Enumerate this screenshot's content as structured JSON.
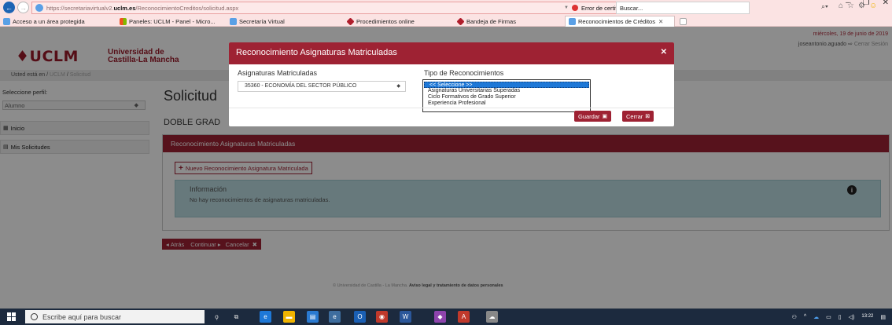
{
  "browser": {
    "url_prefix": "https://secretariavirtualv2.",
    "url_domain": "uclm.es",
    "url_path": "/ReconocimientoCreditos/solicitud.aspx",
    "cert_error": "Error de certificado",
    "search_placeholder": "Buscar...",
    "favorites": [
      "Acceso a un área protegida",
      "Paneles: UCLM - Panel - Micro...",
      "Secretaría Virtual",
      "Procedimientos online",
      "Bandeja de Firmas"
    ],
    "active_tab": "Reconocimientos de Créditos"
  },
  "header": {
    "logo_mark": "♦UCLM",
    "logo_line1": "Universidad de",
    "logo_line2": "Castilla-La Mancha",
    "date": "miércoles, 19 de junio de 2019",
    "user": "joseantonio.aguado",
    "logout": "Cerrar Sesión"
  },
  "breadcrumb": {
    "prefix": "Usted está en",
    "items": [
      "UCLM",
      "Solicitud"
    ]
  },
  "sidebar": {
    "profile_label": "Seleccione perfil:",
    "profile_value": "Alumno",
    "items": [
      "Inicio",
      "Mis Solicitudes"
    ]
  },
  "main": {
    "title": "Solicitud",
    "subtitle": "DOBLE GRAD",
    "panel_title": "Reconocimiento Asignaturas Matriculadas",
    "new_button": "Nuevo Reconocimiento Asignatura Matriculada",
    "info_title": "Información",
    "info_text": "No hay reconocimientos de asignaturas matriculadas.",
    "back": "Atrás",
    "continue": "Continuar",
    "cancel": "Cancelar"
  },
  "modal": {
    "title": "Reconocimiento Asignaturas Matriculadas",
    "label_asignaturas": "Asignaturas Matriculadas",
    "asignatura_value": "35360 - ECONOMÍA DEL SECTOR PÚBLICO",
    "label_tipo": "Tipo de Reconocimientos",
    "tipo_options": [
      "<< Seleccione >>",
      "Asignaturas Universitarias Superadas",
      "Ciclo Formativos de Grado Superior",
      "Experiencia Profesional"
    ],
    "save": "Guardar",
    "close": "Cerrar"
  },
  "footer": {
    "copyright": "© Universidad de Castilla - La Mancha.",
    "legal": "Aviso legal y tratamiento de datos personales"
  },
  "taskbar": {
    "search_placeholder": "Escribe aquí para buscar",
    "time": "13:22"
  },
  "colors": {
    "brand": "#9e2233",
    "info_bg": "#bcdde2",
    "select_highlight": "#1e78d7"
  }
}
